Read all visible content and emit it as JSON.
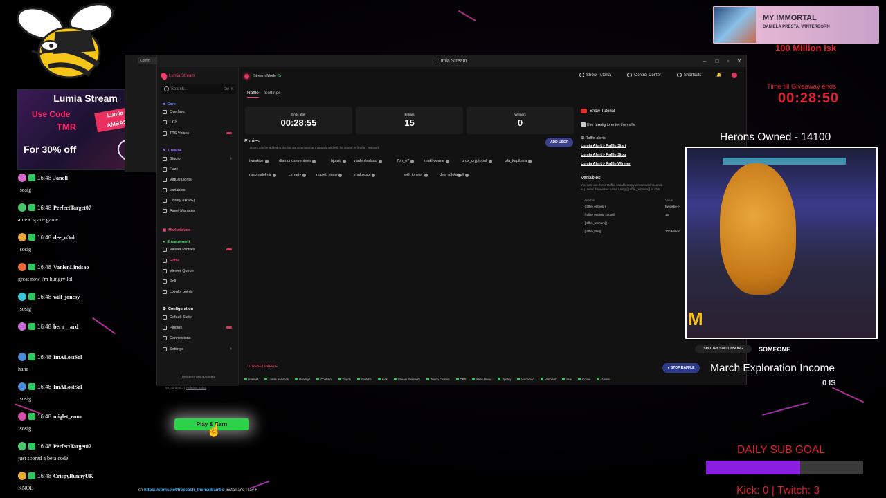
{
  "app": {
    "window_title": "Lumia Stream",
    "brand": "Lumia Stream",
    "search_placeholder": "Search...",
    "search_shortcut": "Ctrl+K",
    "stream_mode_label": "Stream Mode",
    "stream_mode_state": "On",
    "top_buttons": [
      "Show Tutorial",
      "Control Center",
      "Shortcuts"
    ],
    "tabs": [
      "Raffle",
      "Settings"
    ],
    "sidebar": {
      "core_label": "Core",
      "core_items": [
        "Overlays",
        "HFX",
        "TTS Voices"
      ],
      "creator_label": "Creator",
      "creator_items": [
        "Studio",
        "Fuze",
        "Virtual Lights",
        "Variables",
        "Library (IR/RF)",
        "Asset Manager"
      ],
      "marketplace_label": "Marketplace",
      "engagement_label": "Engagement",
      "engagement_items": [
        "Viewer Profiles",
        "Raffle",
        "Viewer Queue",
        "Poll",
        "Loyalty points"
      ],
      "config_label": "Configuration",
      "config_items": [
        "Default State",
        "Plugins",
        "Connections",
        "Settings"
      ],
      "update_text": "Update is not available",
      "version": "v9.0.0-beta.17",
      "release_notes": "Release notes"
    },
    "stats": [
      {
        "label": "Ends after",
        "value": "00:28:55"
      },
      {
        "label": "Entries",
        "value": "15"
      },
      {
        "label": "Winners",
        "value": "0"
      }
    ],
    "entries_title": "Entries",
    "entries_desc": "Users can be added to the list via command or manually and will be stored in {{raffle_entries}}",
    "add_user": "ADD USER",
    "entries": [
      "tweakbe",
      "diamondseventeen",
      "bjorntj",
      "vanlenlindsao",
      "7oh_o7",
      "makhooane",
      "urox_cryptobull",
      "zla_kapibara",
      "rasornalelmir",
      "cernetv",
      "miglet_emm",
      "imalostsol",
      "will_jonesy",
      "dee_n3oh",
      "janoll"
    ],
    "right": {
      "show_tutorial": "Show Tutorial",
      "use_prefix": "Use",
      "use_cmd": "!sosig",
      "use_suffix": "to enter the raffle",
      "alerts_title": "Raffle alerts",
      "alerts": [
        "Lumia Alert > Raffle Start",
        "Lumia Alert > Raffle Stop",
        "Lumia Alert > Raffle Winner"
      ],
      "variables_title": "Variables",
      "variables_desc1": "You can use these Raffle variables any where within Lumia",
      "variables_desc2": "e.g. send the winner name using {{raffle_winners}} in chat",
      "var_head": [
        "Variable",
        "Value"
      ],
      "vars": [
        {
          "name": "{{raffle_entries}}",
          "value": "tweakbe->"
        },
        {
          "name": "{{raffle_entries_count}}",
          "value": "15"
        },
        {
          "name": "{{raffle_winners}}",
          "value": ""
        },
        {
          "name": "{{raffle_title}}",
          "value": "100 Million"
        }
      ]
    },
    "reset_raffle": "RESET RAFFLE",
    "stop_raffle": "STOP RAFFLE",
    "status_items": [
      "Internet",
      "Lumia Services",
      "Overlays",
      "Chat Bot",
      "Twitch",
      "Youtube",
      "Kick",
      "Stream Elements",
      "Twitch Chatbot",
      "OBS",
      "Meld Studio",
      "Spotify",
      "Voicemod",
      "Nanoleaf",
      "Hue",
      "Govee",
      "Govee"
    ]
  },
  "ad": {
    "title": "Lumia Stream",
    "line1": "Use Code",
    "line2": "TMR",
    "line3": "For 30% off",
    "ambassador": "Lumia Stream AMBASSADOR"
  },
  "chat": [
    {
      "time": "16:48",
      "user": "Janoll",
      "msg": "!sosig",
      "color": "#d66acb"
    },
    {
      "time": "16:48",
      "user": "PerfectTarget07",
      "msg": "a new space game",
      "color": "#4ac76a"
    },
    {
      "time": "16:48",
      "user": "dee_n3oh",
      "msg": "!sosig",
      "color": "#e8a83a"
    },
    {
      "time": "16:48",
      "user": "VanlenLindsao",
      "msg": "great now i'm hungry lol",
      "color": "#e86a3a"
    },
    {
      "time": "16:48",
      "user": "will_jonesy",
      "msg": "!sosig",
      "color": "#3ac7d6"
    },
    {
      "time": "16:48",
      "user": "bern__ard",
      "msg": "",
      "color": "#c86ad6"
    },
    {
      "time": "16:48",
      "user": "ImALostSol",
      "msg": "haha",
      "color": "#4a8ad6"
    },
    {
      "time": "16:48",
      "user": "ImALostSol",
      "msg": "!sosig",
      "color": "#4a8ad6"
    },
    {
      "time": "16:48",
      "user": "miglet_emm",
      "msg": "!sosig",
      "color": "#d64aa8"
    },
    {
      "time": "16:48",
      "user": "PerfectTarget07",
      "msg": "just scored a beta code",
      "color": "#4ac76a"
    },
    {
      "time": "16:48",
      "user": "CrispyBunnyUK",
      "msg": "KNOB",
      "color": "#e8a83a"
    }
  ],
  "overlay": {
    "song_title": "MY IMMORTAL",
    "song_artist": "DANIELA PRESTA, WINTERBORN",
    "isk": "100 Million Isk",
    "giveaway_label": "Time till Giveaway ends",
    "giveaway_time": "00:28:50",
    "herons": "Herons Owned - 14100",
    "spotify_label": "SPOTIFY SWITCHSONG",
    "spotify_user": "SOMEONE",
    "march": "March Exploration Income",
    "march_sub": "0 IS",
    "daily_sub": "DAILY SUB GOAL",
    "daily_sub_progress": 0.6,
    "kick_twitch": "Kick: 0 | Twitch: 3",
    "play_earn": "Play & Earn",
    "ticker_prefix": "sh",
    "ticker_link": "https://strms.net/freecash_themadrambo",
    "ticker_suffix": "Install and Play F"
  }
}
